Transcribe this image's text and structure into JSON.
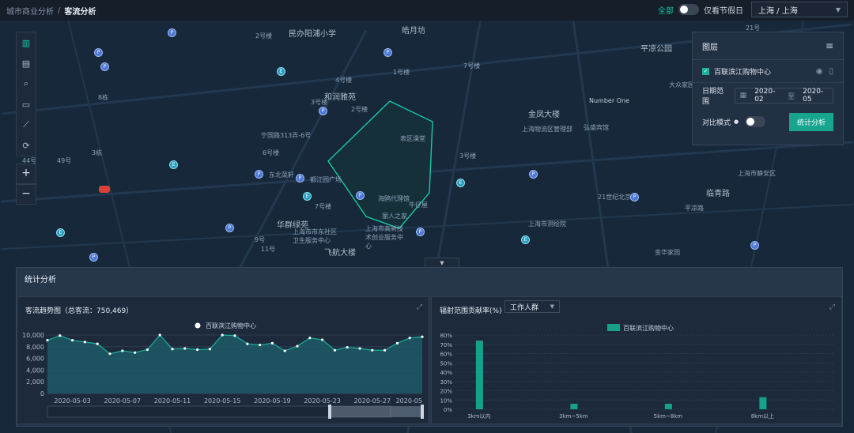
{
  "breadcrumb": {
    "parent": "城市商业分析",
    "current": "客流分析"
  },
  "header": {
    "all_label": "全部",
    "holiday_label": "仅看节假日",
    "city": "上海 / 上海"
  },
  "map": {
    "labels": [
      "民办阳浦小学",
      "皓月坊",
      "平凉公园",
      "和润雅苑",
      "金凤大楼",
      "Number One",
      "宁国路313弄-6号",
      "东北菜轩",
      "都江园广场",
      "海鸥代理馆",
      "牛仔屋",
      "丽人之家",
      "华群绿苑",
      "上海市市东社区卫生服务中心",
      "上海市高新技术创业服务中心",
      "飞航大楼",
      "临青路",
      "上海市测绘院",
      "平凉路",
      "上海市静安区",
      "表区澡堂",
      "弘盛宾馆",
      "21世纪北京",
      "上海物流区管理部",
      "金华家园",
      "大众家园"
    ],
    "numbers": [
      "2号楼",
      "4号楼",
      "3号楼",
      "2号楼",
      "1号楼",
      "7号楼",
      "6号楼",
      "8栋",
      "3栋",
      "49号",
      "3号楼",
      "9号",
      "11号",
      "7号楼",
      "44号",
      "21号"
    ]
  },
  "layer_panel": {
    "title": "图层",
    "layer_name": "百联滨江购物中心",
    "date_label": "日期范围",
    "date_start": "2020-02",
    "date_sep": "至",
    "date_end": "2020-05",
    "compare_label": "对比模式",
    "analyze_button": "统计分析"
  },
  "stats": {
    "title": "统计分析"
  },
  "trend": {
    "title": "客流趋势图（总客流：750,469）"
  },
  "contrib": {
    "title": "辐射范围贡献率(%)",
    "select": "工作人群"
  },
  "chart_data": [
    {
      "type": "area",
      "title": "客流趋势图（总客流：750,469）",
      "legend": [
        "百联滨江购物中心"
      ],
      "legend_position": "top",
      "x": [
        "2020-05-01",
        "2020-05-02",
        "2020-05-03",
        "2020-05-04",
        "2020-05-05",
        "2020-05-06",
        "2020-05-07",
        "2020-05-08",
        "2020-05-09",
        "2020-05-10",
        "2020-05-11",
        "2020-05-12",
        "2020-05-13",
        "2020-05-14",
        "2020-05-15",
        "2020-05-16",
        "2020-05-17",
        "2020-05-18",
        "2020-05-19",
        "2020-05-20",
        "2020-05-21",
        "2020-05-22",
        "2020-05-23",
        "2020-05-24",
        "2020-05-25",
        "2020-05-26",
        "2020-05-27",
        "2020-05-28",
        "2020-05-29",
        "2020-05-30",
        "2020-05-31"
      ],
      "x_tick_labels": [
        "2020-05-03",
        "2020-05-07",
        "2020-05-11",
        "2020-05-15",
        "2020-05-19",
        "2020-05-23",
        "2020-05-27",
        "2020-05"
      ],
      "series": [
        {
          "name": "百联滨江购物中心",
          "values": [
            9100,
            9900,
            9100,
            8800,
            8500,
            6800,
            7300,
            7000,
            7500,
            10000,
            7600,
            7700,
            7500,
            7600,
            10000,
            9900,
            8500,
            8300,
            8600,
            7300,
            8100,
            9500,
            9200,
            7400,
            7900,
            7700,
            7400,
            7400,
            8600,
            9500,
            9700
          ]
        }
      ],
      "y_ticks": [
        0,
        2000,
        4000,
        6000,
        8000,
        10000
      ],
      "y_tick_labels": [
        "0",
        "2,000",
        "4,000",
        "6,000",
        "8,000",
        "10,000"
      ],
      "ylim": [
        0,
        10000
      ],
      "color": "#19b39b"
    },
    {
      "type": "bar",
      "title": "辐射范围贡献率(%)",
      "legend": [
        "百联滨江购物中心"
      ],
      "legend_position": "top",
      "categories": [
        "3km以内",
        "3km~5km",
        "5km~8km",
        "8km以上"
      ],
      "series": [
        {
          "name": "百联滨江购物中心",
          "values": [
            74,
            6,
            6,
            13
          ]
        }
      ],
      "y_ticks": [
        0,
        10,
        20,
        30,
        40,
        50,
        60,
        70,
        80
      ],
      "y_tick_labels": [
        "0%",
        "10%",
        "20%",
        "30%",
        "40%",
        "50%",
        "60%",
        "70%",
        "80%"
      ],
      "ylim": [
        0,
        80
      ],
      "color": "#19a08c"
    }
  ]
}
